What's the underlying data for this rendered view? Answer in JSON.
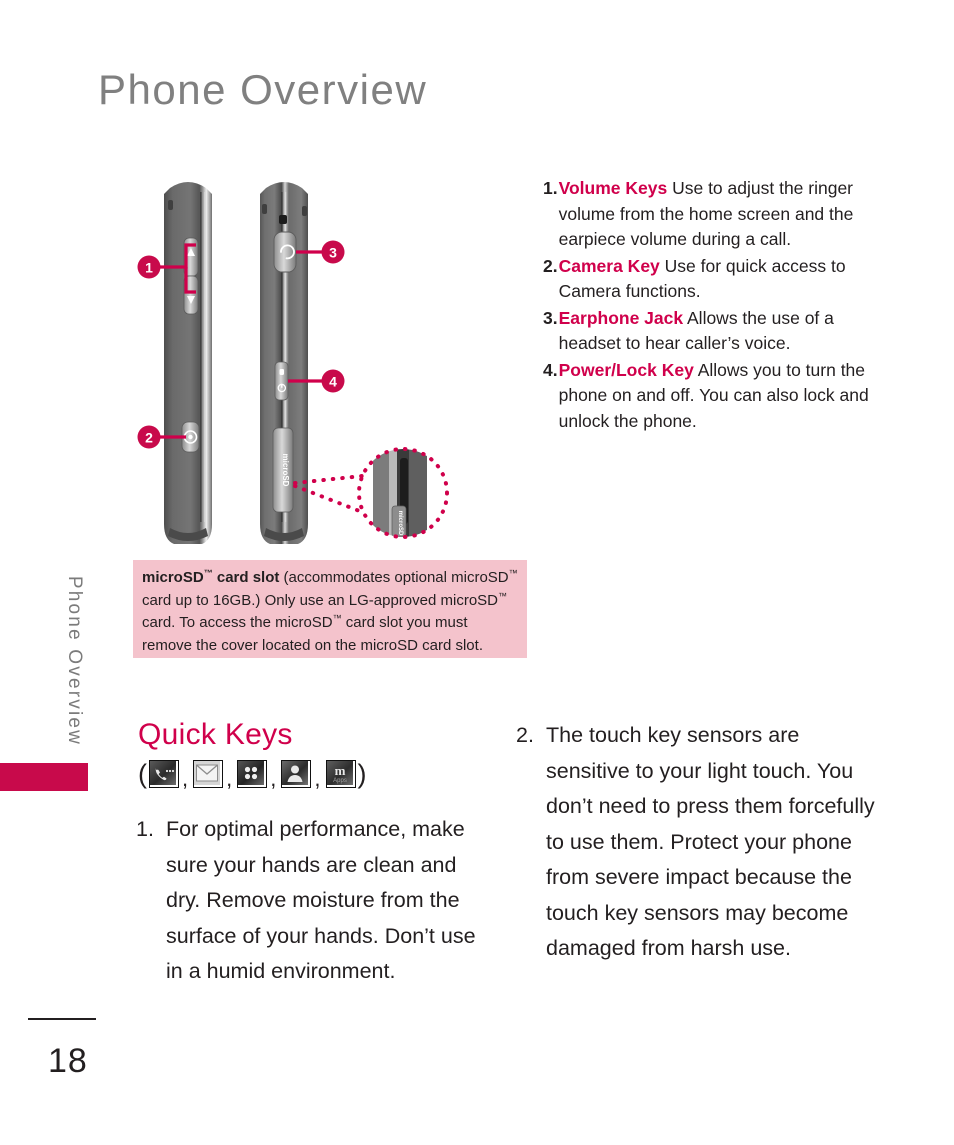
{
  "page": {
    "title": "Phone Overview",
    "side_tab_label": "Phone Overview",
    "page_number": "18",
    "accent_color": "#d0004b",
    "tab_block_color": "#c80a4b",
    "note_bg_color": "#f4c3cc",
    "title_color": "#808080"
  },
  "diagram": {
    "name": "phone-side-views-diagram",
    "callout_markers": [
      "1",
      "2",
      "3",
      "4"
    ],
    "left_phone_labels": [
      "1",
      "2"
    ],
    "right_phone_labels": [
      "3",
      "4"
    ],
    "microsd_label": "microSD",
    "magnifier_caption": "microSD card slot detail"
  },
  "callouts": [
    {
      "num": "1.",
      "keyword": "Volume Keys",
      "text": " Use to adjust the ringer volume from the home screen and the earpiece volume during a call."
    },
    {
      "num": "2.",
      "keyword": "Camera Key",
      "text": " Use for quick access to Camera functions."
    },
    {
      "num": "3.",
      "keyword": "Earphone Jack",
      "text": " Allows the use of a headset to hear caller’s voice."
    },
    {
      "num": "4.",
      "keyword": "Power/Lock Key",
      "text": " Allows you to turn the phone on and off. You can also lock and unlock the phone."
    }
  ],
  "note": {
    "bold_lead": "microSD",
    "bold_lead_tm": "™",
    "bold_rest": " card slot",
    "body_1": " (accommodates optional microSD",
    "tm": "™",
    "body_2": " card up to 16GB.) Only use an LG-approved microSD",
    "body_3": " card. To access the microSD",
    "body_4": " card slot you must remove the cover located on the microSD card slot."
  },
  "quick_keys": {
    "heading": "Quick Keys",
    "open_paren": "(",
    "close_paren": ")",
    "separator": ",",
    "icons": [
      {
        "name": "phone-call-icon",
        "label": "Phone"
      },
      {
        "name": "envelope-message-icon",
        "label": "Messaging"
      },
      {
        "name": "four-dot-grid-menu-icon",
        "label": "Menu"
      },
      {
        "name": "contacts-person-icon",
        "label": "Contacts"
      },
      {
        "name": "m-apps-icon",
        "label": "Apps",
        "glyph": "m",
        "sublabel": "Apps"
      }
    ]
  },
  "body_items": {
    "left": {
      "num": "1.",
      "text": "For optimal performance, make sure your hands are clean and dry. Remove moisture from the surface of your hands. Don’t use in a humid environment."
    },
    "right": {
      "num": "2.",
      "text": "The touch key sensors are sensitive to your light touch. You don’t need to press them forcefully to use them. Protect your phone from severe impact because the touch key sensors may become damaged from harsh use."
    }
  }
}
